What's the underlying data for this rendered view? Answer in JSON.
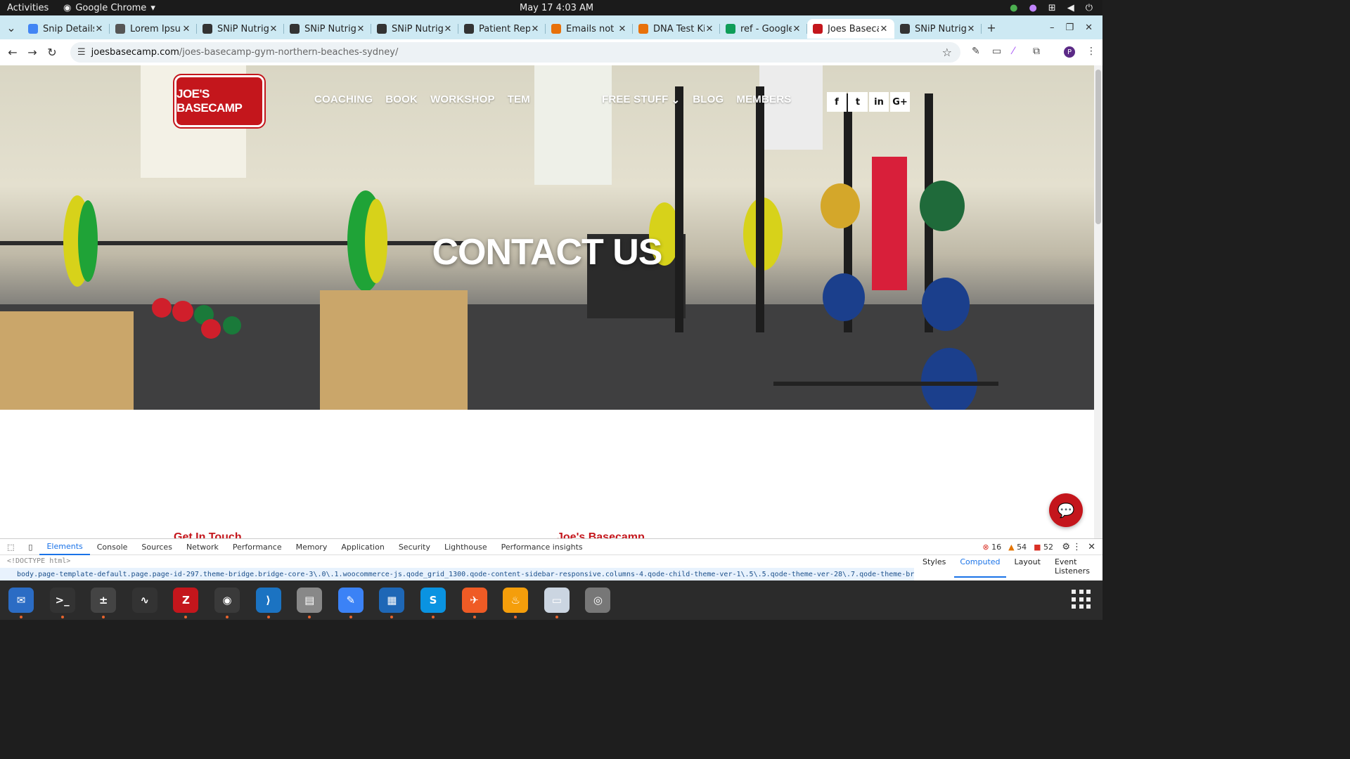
{
  "topbar": {
    "activities": "Activities",
    "app": "Google Chrome",
    "clock": "May 17  4:03 AM"
  },
  "tabs": [
    {
      "title": "Snip Details",
      "fav": "doc",
      "color": "#4285f4"
    },
    {
      "title": "Lorem Ipsum",
      "fav": "L",
      "color": "#555"
    },
    {
      "title": "SNiP Nutrige",
      "fav": "SN",
      "color": "#333"
    },
    {
      "title": "SNiP Nutrige",
      "fav": "SN",
      "color": "#333"
    },
    {
      "title": "SNiP Nutrige",
      "fav": "SN",
      "color": "#333"
    },
    {
      "title": "Patient Rep",
      "fav": "SN",
      "color": "#333"
    },
    {
      "title": "Emails not s",
      "fav": "chrome",
      "color": "#e8710a"
    },
    {
      "title": "DNA Test Ki",
      "fav": "chrome",
      "color": "#e8710a"
    },
    {
      "title": "ref - Google",
      "fav": "sheet",
      "color": "#0f9d58"
    },
    {
      "title": "Joes Baseca",
      "fav": "jb",
      "color": "#c4161c",
      "active": true
    },
    {
      "title": "SNiP Nutrige",
      "fav": "SN",
      "color": "#333"
    }
  ],
  "address": {
    "host": "joesbasecamp.com",
    "path": "/joes-basecamp-gym-northern-beaches-sydney/"
  },
  "site": {
    "logo_text": "JOE'S BASECAMP",
    "nav": [
      "COACHING",
      "BOOK",
      "WORKSHOP",
      "TEM",
      "",
      "FREE STUFF",
      "BLOG",
      "MEMBERS"
    ],
    "social": [
      "f",
      "t",
      "in",
      "G+"
    ],
    "hero_title": "CONTACT US",
    "section_left": "Get In Touch",
    "section_right": "Joe's Basecamp"
  },
  "devtools": {
    "tabs": [
      "Elements",
      "Console",
      "Sources",
      "Network",
      "Performance",
      "Memory",
      "Application",
      "Security",
      "Lighthouse",
      "Performance insights"
    ],
    "errors": "16",
    "warnings": "54",
    "issues": "52",
    "doctype": "<!DOCTYPE html>",
    "breadcrumb": "body.page-template-default.page.page-id-297.theme-bridge.bridge-core-3\\.0\\.1.woocommerce-js.qode_grid_1300.qode-content-sidebar-responsive.columns-4.qode-child-theme-ver-1\\.5\\.5.qode-theme-ver-28\\.7.qode-theme-bridge.disabled_footer_bottom.qode_header_in_grid.wpb-js",
    "side_tabs": [
      "Styles",
      "Computed",
      "Layout",
      "Event Listeners"
    ]
  },
  "dock": [
    {
      "name": "thunderbird",
      "color": "#2b6cc4"
    },
    {
      "name": "terminal",
      "color": "#333"
    },
    {
      "name": "calculator",
      "color": "#444"
    },
    {
      "name": "system-monitor",
      "color": "#333"
    },
    {
      "name": "filezilla",
      "color": "#c4161c"
    },
    {
      "name": "chrome",
      "color": "#3a3a3a"
    },
    {
      "name": "vscode",
      "color": "#1b73c2"
    },
    {
      "name": "files",
      "color": "#888"
    },
    {
      "name": "text-editor",
      "color": "#3b82f6"
    },
    {
      "name": "writer",
      "color": "#1e67b6"
    },
    {
      "name": "skype",
      "color": "#0a93e1"
    },
    {
      "name": "postman",
      "color": "#ef5b25"
    },
    {
      "name": "lamp",
      "color": "#f59e0b"
    },
    {
      "name": "reader",
      "color": "#cbd5e1"
    },
    {
      "name": "disks",
      "color": "#777"
    }
  ]
}
